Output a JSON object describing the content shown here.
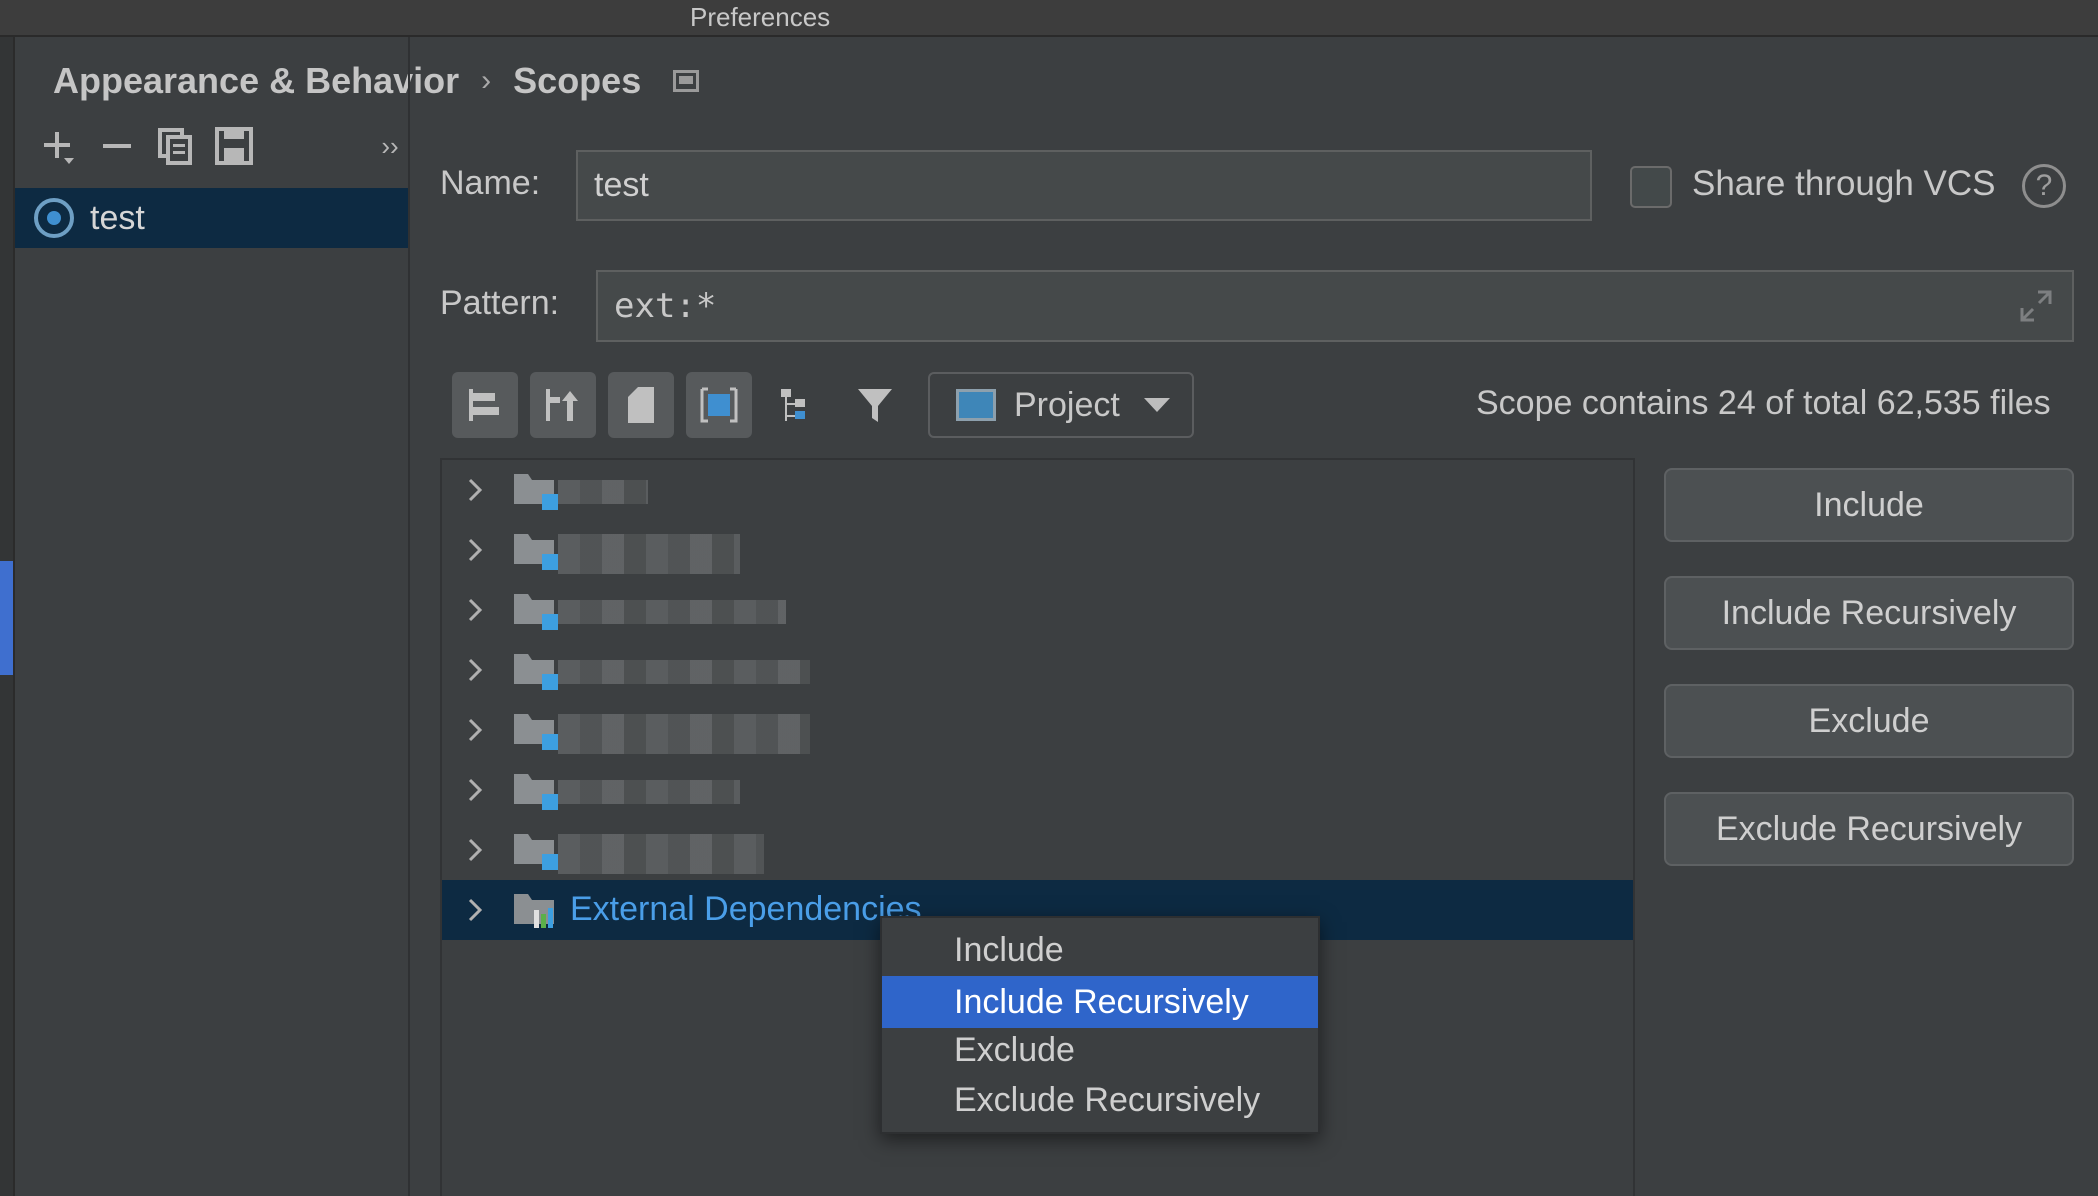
{
  "window": {
    "title": "Preferences"
  },
  "breadcrumb": {
    "parent": "Appearance & Behavior",
    "separator": "›",
    "current": "Scopes"
  },
  "scopes": {
    "items": [
      {
        "label": "test",
        "selected": true
      }
    ]
  },
  "form": {
    "name_label": "Name:",
    "name_value": "test",
    "share_vcs_label": "Share through VCS",
    "share_vcs_checked": false,
    "help_glyph": "?",
    "pattern_label": "Pattern:",
    "pattern_value": "ext:*"
  },
  "tree_toolbar": {
    "view_dropdown": "Project",
    "scope_count_text": "Scope contains 24 of total 62,535 files"
  },
  "tree": {
    "rows": [
      {
        "label": "",
        "icon": "module-folder-icon",
        "blurred": true
      },
      {
        "label": "",
        "icon": "module-folder-icon",
        "blurred": true
      },
      {
        "label": "",
        "icon": "module-folder-icon",
        "blurred": true
      },
      {
        "label": "",
        "icon": "module-folder-icon",
        "blurred": true
      },
      {
        "label": "",
        "icon": "module-folder-icon",
        "blurred": true
      },
      {
        "label": "",
        "icon": "module-folder-icon",
        "blurred": true
      },
      {
        "label": "",
        "icon": "module-folder-icon",
        "blurred": true
      },
      {
        "label": "External Dependencies",
        "icon": "library-icon",
        "selected": true
      }
    ]
  },
  "actions": {
    "include": "Include",
    "include_recursively": "Include Recursively",
    "exclude": "Exclude",
    "exclude_recursively": "Exclude Recursively"
  },
  "context_menu": {
    "items": [
      "Include",
      "Include Recursively",
      "Exclude",
      "Exclude Recursively"
    ],
    "highlighted": "Include Recursively"
  },
  "colors": {
    "selection_bg": "#0d2a42",
    "menu_highlight": "#2f65ca",
    "link_blue": "#4a9ee8",
    "accent": "#3f6fcf"
  }
}
